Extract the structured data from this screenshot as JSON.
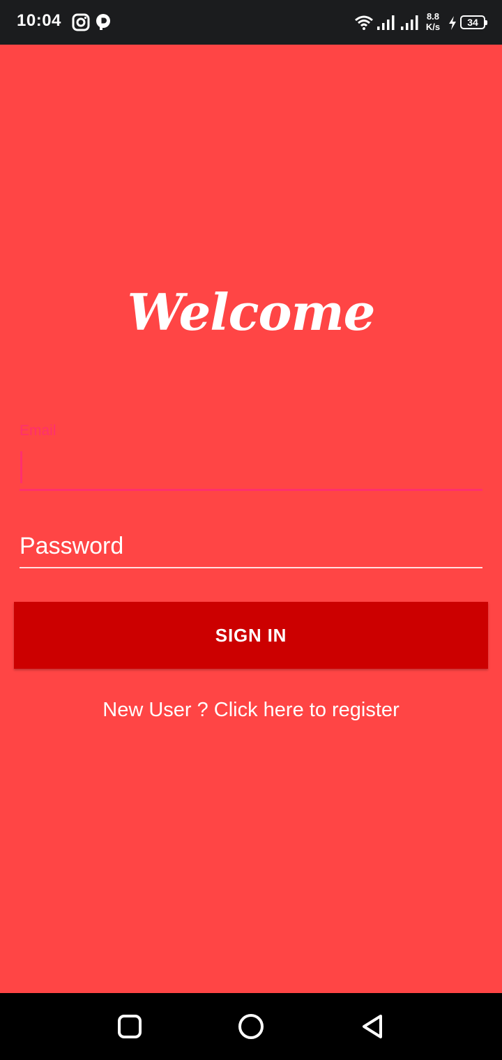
{
  "status_bar": {
    "time": "10:04",
    "network_speed_value": "8.8",
    "network_speed_unit": "K/s",
    "battery_level": "34",
    "icons": [
      "instagram-icon",
      "pinterest-icon",
      "wifi-icon",
      "signal-icon",
      "signal-icon",
      "charging-icon",
      "battery-icon"
    ]
  },
  "login": {
    "welcome_title": "Welcome",
    "email_label": "Email",
    "email_value": "",
    "password_placeholder": "Password",
    "signin_label": "SIGN IN",
    "register_link": "New User ? Click here to register"
  },
  "nav_bar": {
    "icons": [
      "recents-icon",
      "home-icon",
      "back-icon"
    ]
  },
  "colors": {
    "background": "#ff4545",
    "status_bar": "#1b1c1e",
    "button": "#cc0000",
    "accent": "#ff2f6d",
    "text": "#ffffff"
  }
}
